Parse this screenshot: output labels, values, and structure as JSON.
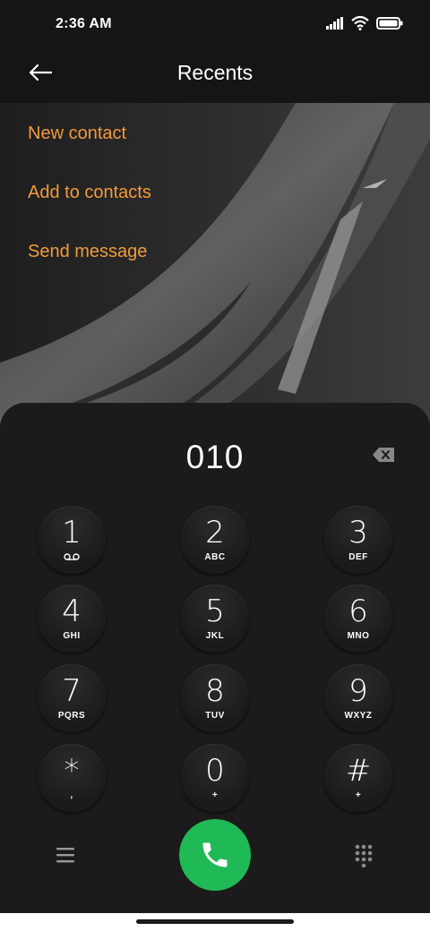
{
  "status": {
    "time": "2:36 AM"
  },
  "header": {
    "title": "Recents"
  },
  "menu": {
    "items": [
      "New contact",
      "Add to contacts",
      "Send message"
    ]
  },
  "dialer": {
    "number": "010",
    "keys": [
      {
        "digit": "1",
        "letters": ""
      },
      {
        "digit": "2",
        "letters": "ABC"
      },
      {
        "digit": "3",
        "letters": "DEF"
      },
      {
        "digit": "4",
        "letters": "GHI"
      },
      {
        "digit": "5",
        "letters": "JKL"
      },
      {
        "digit": "6",
        "letters": "MNO"
      },
      {
        "digit": "7",
        "letters": "PQRS"
      },
      {
        "digit": "8",
        "letters": "TUV"
      },
      {
        "digit": "9",
        "letters": "WXYZ"
      },
      {
        "digit": "*",
        "letters": ","
      },
      {
        "digit": "0",
        "letters": "+"
      },
      {
        "digit": "#",
        "letters": "+"
      }
    ]
  },
  "icons": {
    "back": "arrow-left-icon",
    "delete": "backspace-icon",
    "voicemail": "voicemail-icon",
    "call": "phone-icon",
    "menu": "hamburger-icon",
    "dialpad": "dialpad-icon"
  },
  "colors": {
    "accent": "#f29a3b",
    "call": "#1fb955",
    "panel": "#1b1b1b"
  }
}
